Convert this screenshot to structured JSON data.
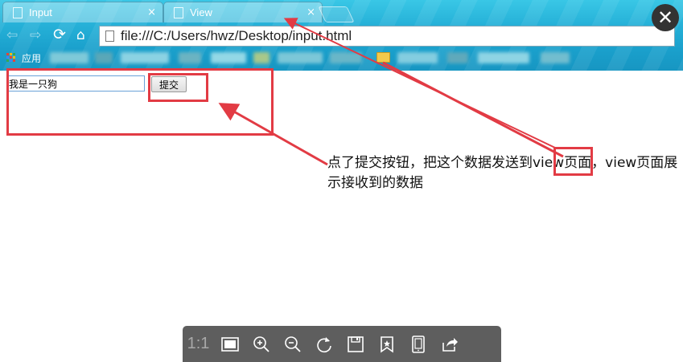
{
  "browser": {
    "tabs": [
      {
        "title": "Input",
        "close": "×"
      },
      {
        "title": "View",
        "close": "×"
      }
    ],
    "address": "file:///C:/Users/hwz/Desktop/input.html",
    "bookmarks": {
      "apps_label": "应用"
    },
    "nav_icons": [
      "back-arrow-icon",
      "forward-arrow-icon",
      "reload-icon",
      "home-icon"
    ]
  },
  "page": {
    "input_value": "我是一只狗",
    "submit_label": "提交"
  },
  "annotation": {
    "text_before": "点了提交按钮，把这个数据发送到",
    "text_highlight": "view",
    "text_after": "页面，view页面展示接收到的数据"
  },
  "viewer": {
    "close": "✕",
    "zoom_ratio": "1:1",
    "tools": [
      "actual-size",
      "fit-screen-icon",
      "zoom-in-icon",
      "zoom-out-icon",
      "rotate-icon",
      "save-icon",
      "bookmark-icon",
      "tablet-icon",
      "share-icon"
    ]
  },
  "colors": {
    "highlight_red": "#e23b44",
    "chrome_blue": "#26b1d8",
    "toolbar_gray": "#5e5e5e"
  }
}
